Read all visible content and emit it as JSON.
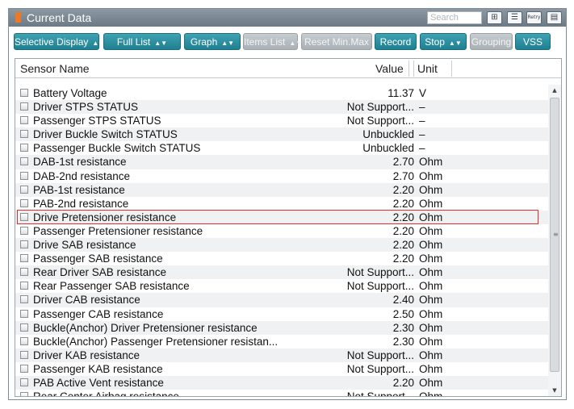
{
  "title": "Current Data",
  "search": {
    "placeholder": "Search"
  },
  "title_icons": [
    "zoom-icon",
    "list-icon",
    "retry-icon",
    "layout-icon"
  ],
  "retry_label": "Retry",
  "toolbar": {
    "selective_display": "Selective Display",
    "full_list": "Full List",
    "graph": "Graph",
    "items_list": "Items List",
    "reset_min_max": "Reset Min.Max",
    "record": "Record",
    "stop": "Stop",
    "grouping": "Grouping",
    "vss": "VSS"
  },
  "columns": {
    "name": "Sensor Name",
    "value": "Value",
    "unit": "Unit"
  },
  "rows": [
    {
      "name": "Battery Voltage",
      "value": "11.37",
      "unit": "V"
    },
    {
      "name": "Driver STPS STATUS",
      "value": "Not Support...",
      "unit": "–"
    },
    {
      "name": "Passenger STPS STATUS",
      "value": "Not Support...",
      "unit": "–"
    },
    {
      "name": "Driver Buckle Switch STATUS",
      "value": "Unbuckled",
      "unit": "–"
    },
    {
      "name": "Passenger Buckle Switch STATUS",
      "value": "Unbuckled",
      "unit": "–"
    },
    {
      "name": "DAB-1st resistance",
      "value": "2.70",
      "unit": "Ohm"
    },
    {
      "name": "DAB-2nd resistance",
      "value": "2.70",
      "unit": "Ohm"
    },
    {
      "name": "PAB-1st resistance",
      "value": "2.20",
      "unit": "Ohm"
    },
    {
      "name": "PAB-2nd resistance",
      "value": "2.20",
      "unit": "Ohm"
    },
    {
      "name": "Drive Pretensioner resistance",
      "value": "2.20",
      "unit": "Ohm"
    },
    {
      "name": "Passenger Pretensioner resistance",
      "value": "2.20",
      "unit": "Ohm"
    },
    {
      "name": "Drive SAB resistance",
      "value": "2.20",
      "unit": "Ohm"
    },
    {
      "name": "Passenger SAB resistance",
      "value": "2.20",
      "unit": "Ohm"
    },
    {
      "name": "Rear Driver SAB resistance",
      "value": "Not Support...",
      "unit": "Ohm"
    },
    {
      "name": "Rear Passenger SAB resistance",
      "value": "Not Support...",
      "unit": "Ohm"
    },
    {
      "name": "Driver CAB resistance",
      "value": "2.40",
      "unit": "Ohm"
    },
    {
      "name": "Passenger CAB resistance",
      "value": "2.50",
      "unit": "Ohm"
    },
    {
      "name": "Buckle(Anchor) Driver Pretensioner resistance",
      "value": "2.30",
      "unit": "Ohm"
    },
    {
      "name": "Buckle(Anchor) Passenger Pretensioner resistan...",
      "value": "2.30",
      "unit": "Ohm"
    },
    {
      "name": "Driver KAB resistance",
      "value": "Not Support...",
      "unit": "Ohm"
    },
    {
      "name": "Passenger KAB resistance",
      "value": "Not Support...",
      "unit": "Ohm"
    },
    {
      "name": "PAB Active Vent resistance",
      "value": "2.20",
      "unit": "Ohm"
    },
    {
      "name": "Rear Center Airbag resistance",
      "value": "Not Support...",
      "unit": "Ohm"
    }
  ],
  "highlighted_row": "Drive Pretensioner resistance",
  "colors": {
    "accent": "#2590a3",
    "disabled": "#b5bcc1",
    "highlight": "#e12d2d",
    "titlebar": "#7a8792"
  }
}
